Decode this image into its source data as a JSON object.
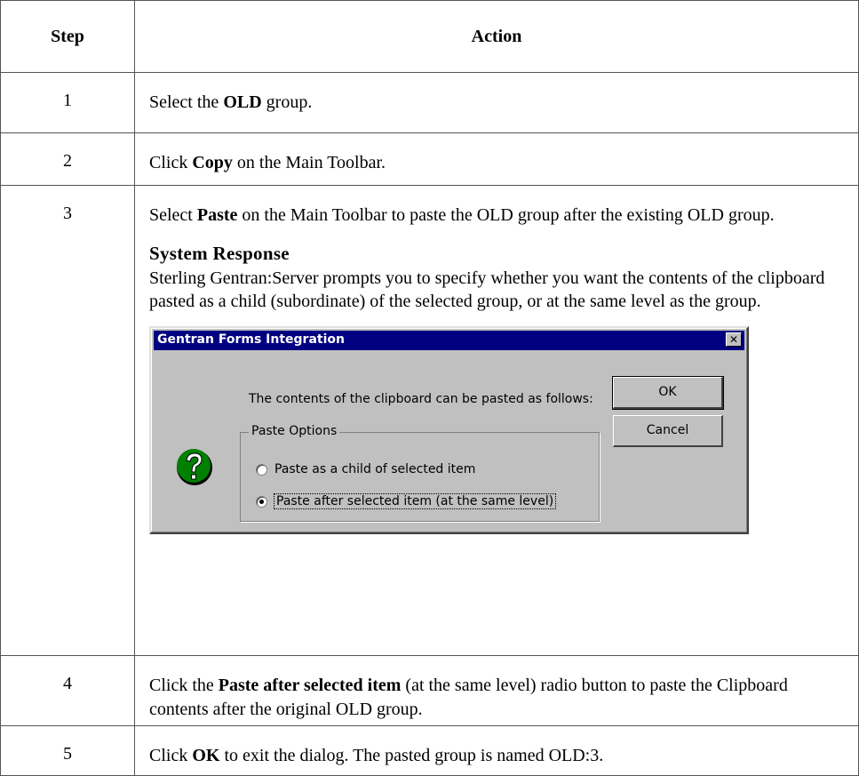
{
  "table": {
    "headers": {
      "step": "Step",
      "action": "Action"
    },
    "rows": [
      {
        "step": "1",
        "pre": "Select the ",
        "bold": "OLD",
        "post": " group."
      },
      {
        "step": "2",
        "pre": "Click ",
        "bold": "Copy",
        "post": " on the Main Toolbar."
      },
      {
        "step": "3",
        "pre": "Select ",
        "bold": "Paste",
        "post": " on the Main Toolbar to paste the OLD group after the existing OLD group.",
        "response_title": "System Response",
        "response_text": "Sterling Gentran:Server prompts you to specify whether you want the contents of the clipboard pasted as a child (subordinate) of the selected group, or at the same level as the group."
      },
      {
        "step": "4",
        "pre": "Click the ",
        "bold": "Paste after selected item",
        "post": " (at the same level) radio button to paste the Clipboard contents after the original OLD group."
      },
      {
        "step": "5",
        "pre": "Click ",
        "bold": "OK",
        "post": " to exit the dialog. The pasted group is named OLD:3."
      }
    ]
  },
  "dialog": {
    "title": "Gentran Forms Integration",
    "close_glyph": "✕",
    "message": "The contents of the clipboard can be pasted as follows:",
    "ok_label": "OK",
    "cancel_label": "Cancel",
    "icon": "question-icon",
    "group_label": "Paste Options",
    "options": [
      {
        "label": "Paste as a child of selected item",
        "checked": false
      },
      {
        "label": "Paste after selected item (at the same level)",
        "checked": true
      }
    ]
  }
}
